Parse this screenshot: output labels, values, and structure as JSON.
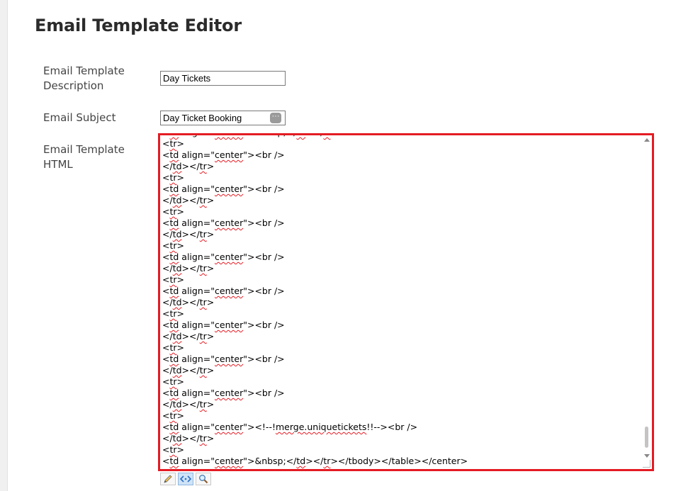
{
  "page": {
    "title": "Email Template Editor"
  },
  "form": {
    "description_label": "Email Template Description",
    "description_value": "Day Tickets",
    "subject_label": "Email Subject",
    "subject_value": "Day Ticket Booking",
    "html_label": "Email Template HTML"
  },
  "editor": {
    "lines": [
      "<td align=\"center\">&nbsp;</td></tr>",
      "<tr>",
      "<td align=\"center\"><br />",
      "</td></tr>",
      "<tr>",
      "<td align=\"center\"><br />",
      "</td></tr>",
      "<tr>",
      "<td align=\"center\"><br />",
      "</td></tr>",
      "<tr>",
      "<td align=\"center\"><br />",
      "</td></tr>",
      "<tr>",
      "<td align=\"center\"><br />",
      "</td></tr>",
      "<tr>",
      "<td align=\"center\"><br />",
      "</td></tr>",
      "<tr>",
      "<td align=\"center\"><br />",
      "</td></tr>",
      "<tr>",
      "<td align=\"center\"><br />",
      "</td></tr>",
      "<tr>",
      "<td align=\"center\"><!--!merge.uniquetickets!!--><br />",
      "</td></tr>",
      "<tr>",
      "<td align=\"center\">&nbsp;</td></tr></tbody></table></center>"
    ]
  },
  "toolbar": {
    "buttons": [
      "pencil-icon",
      "code-icon",
      "magnifier-icon"
    ]
  },
  "colors": {
    "highlight_border": "#e41b23",
    "spell_underline": "#e41b23"
  }
}
